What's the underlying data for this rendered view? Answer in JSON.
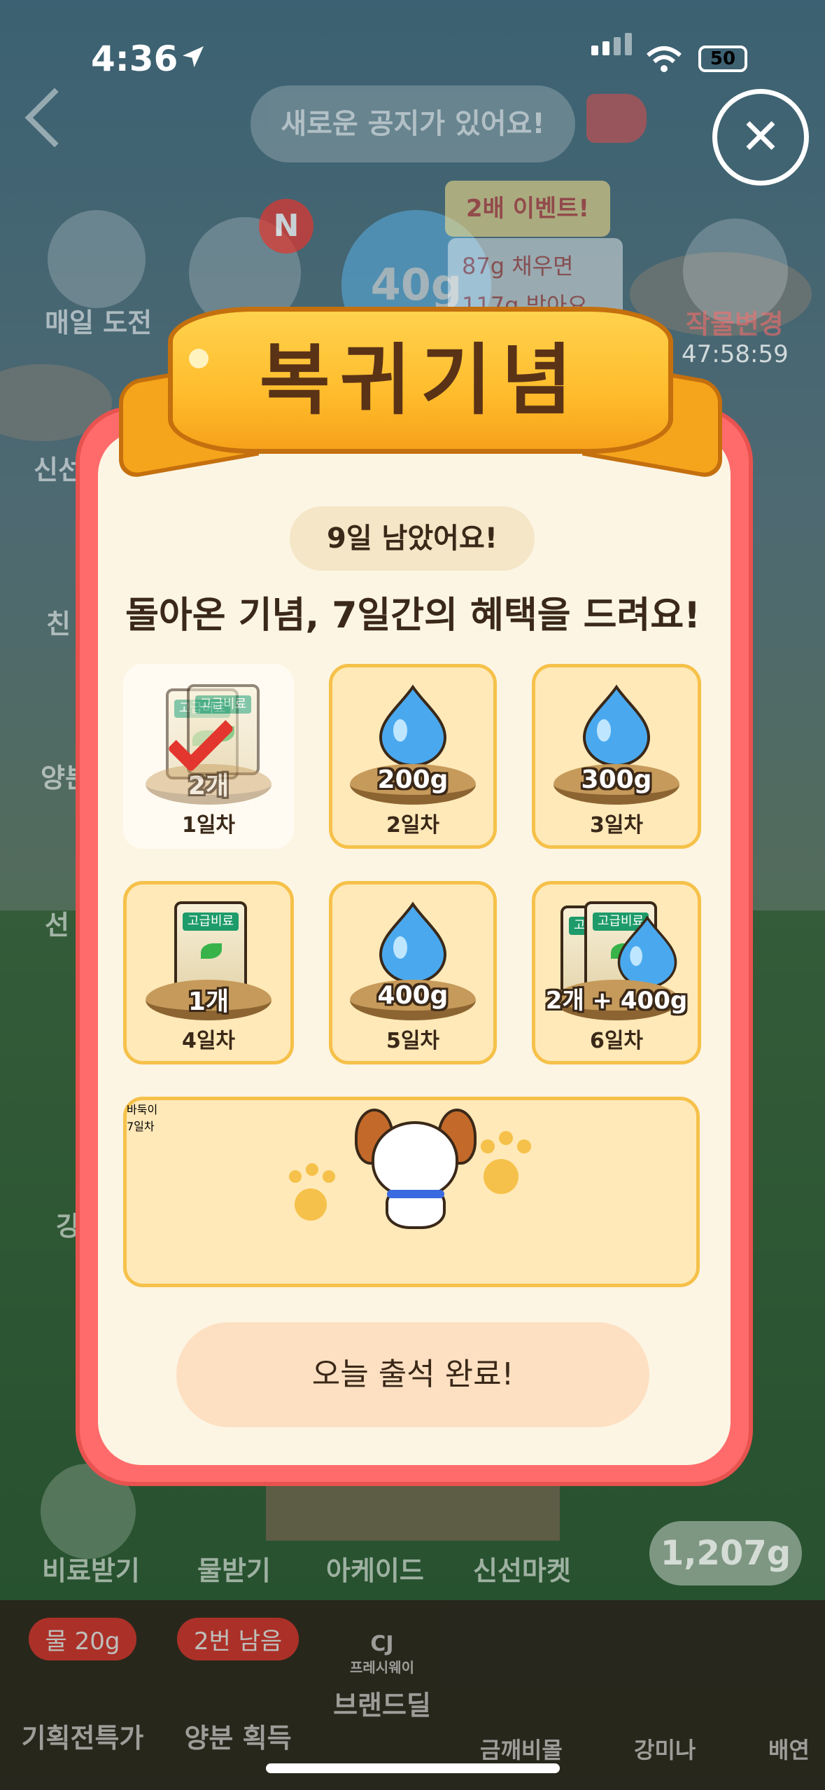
{
  "status_bar": {
    "time": "4:36",
    "battery": "50"
  },
  "background": {
    "notice": "새로운 공지가 있어요!",
    "daily_challenge": "매일 도전",
    "n_badge": "N",
    "gauge_value": "40g",
    "event_title": "2배 이벤트!",
    "event_line1": "87g 채우면",
    "event_line2": "117g 받아요",
    "change_crop": "작물변경",
    "timer": "47:58:59",
    "left_labels": [
      "신선",
      "친",
      "양분",
      "선",
      "강"
    ],
    "bottom_row": [
      "비료받기",
      "물받기",
      "아케이드",
      "신선마켓"
    ],
    "water_total": "1,207g",
    "tabs": [
      {
        "badge": "물 20g",
        "label": "기획전특가"
      },
      {
        "badge": "2번 남음",
        "label": "양분 획득"
      },
      {
        "brand": "CJ",
        "brand_sub": "프레시웨이",
        "label": "브랜드딜"
      },
      {
        "label": "금깨비몰"
      },
      {
        "label": "강미나"
      },
      {
        "label": "배연"
      }
    ]
  },
  "modal": {
    "title": "복귀기념",
    "days_left": "9일 남았어요!",
    "subtitle": "돌아온 기념, 7일간의 혜택을 드려요!",
    "bag_label": "고급비료",
    "rewards": [
      {
        "day": "1일차",
        "amount": "2개",
        "kind": "fertilizer",
        "claimed": true
      },
      {
        "day": "2일차",
        "amount": "200g",
        "kind": "water",
        "claimed": false
      },
      {
        "day": "3일차",
        "amount": "300g",
        "kind": "water",
        "claimed": false
      },
      {
        "day": "4일차",
        "amount": "1개",
        "kind": "fertilizer",
        "claimed": false
      },
      {
        "day": "5일차",
        "amount": "400g",
        "kind": "water",
        "claimed": false
      },
      {
        "day": "6일차",
        "amount": "2개 + 400g",
        "kind": "fertilizer+water",
        "claimed": false
      },
      {
        "day": "7일차",
        "amount": "바둑이",
        "kind": "pet",
        "claimed": false
      }
    ],
    "button_label": "오늘 출석 완료!"
  },
  "colors": {
    "modal_frame": "#ff6b6b",
    "modal_body": "#fcf5e4",
    "banner": "#ffbc2c",
    "card_bg": "#ffe9b8",
    "card_border": "#f6c14a",
    "check": "#e3362e",
    "water_drop": "#4aa9ee"
  }
}
